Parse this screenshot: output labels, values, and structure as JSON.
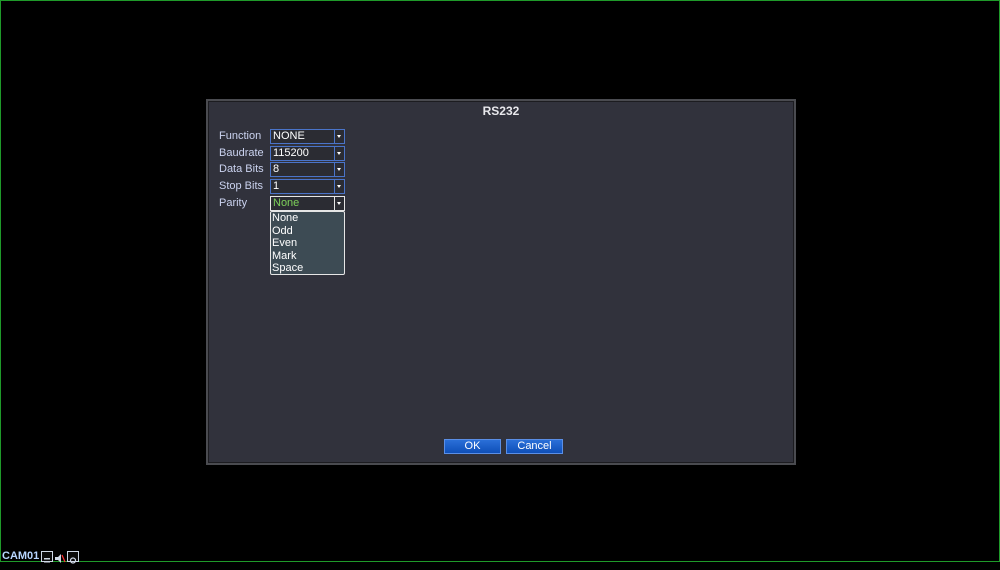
{
  "dialog": {
    "title": "RS232"
  },
  "fields": [
    {
      "label": "Function",
      "value": "NONE"
    },
    {
      "label": "Baudrate",
      "value": "115200"
    },
    {
      "label": "Data Bits",
      "value": "8"
    },
    {
      "label": "Stop Bits",
      "value": "1"
    },
    {
      "label": "Parity",
      "value": "None"
    }
  ],
  "parity_dropdown": {
    "options": [
      "None",
      "Odd",
      "Even",
      "Mark",
      "Space"
    ]
  },
  "buttons": {
    "ok": "OK",
    "cancel": "Cancel"
  },
  "status_bar": {
    "camera": "CAM01",
    "icons": [
      "record-icon",
      "audio-icon",
      "camera-icon"
    ]
  },
  "colors": {
    "screen_border": "#1f9a2a",
    "dialog_bg": "#31323c",
    "label_text": "#cbd3f0",
    "field_border": "#4a74c9",
    "active_value": "#7dd05a",
    "button_bg": "#1560d0"
  }
}
